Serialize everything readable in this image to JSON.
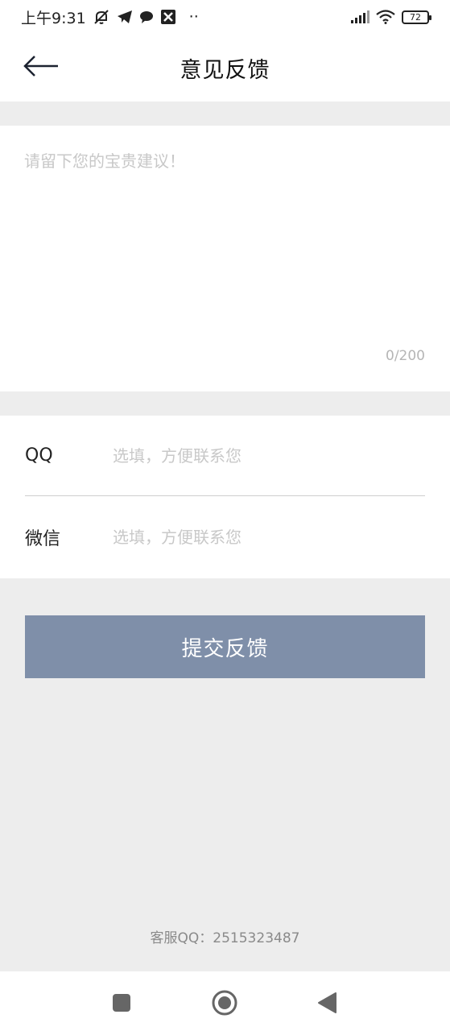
{
  "status_bar": {
    "time": "上午9:31",
    "dots": "··",
    "battery": "72",
    "icons": [
      "muted-bell-icon",
      "telegram-icon",
      "chat-bubble-icon",
      "app-notification-icon",
      "signal-icon",
      "wifi-icon",
      "battery-icon"
    ]
  },
  "header": {
    "title": "意见反馈",
    "back_icon": "arrow-left-icon"
  },
  "feedback": {
    "placeholder": "请留下您的宝贵建议！",
    "value": "",
    "counter": "0/200"
  },
  "contact": {
    "qq": {
      "label": "QQ",
      "placeholder": "选填，方便联系您",
      "value": ""
    },
    "wechat": {
      "label": "微信",
      "placeholder": "选填，方便联系您",
      "value": ""
    }
  },
  "submit": {
    "label": "提交反馈",
    "color": "#7f8fa9"
  },
  "service": {
    "text": "客服QQ：2515323487"
  },
  "nav_bar": {
    "icons": [
      "square-recents-icon",
      "circle-home-icon",
      "triangle-back-icon"
    ]
  },
  "colors": {
    "background": "#ededed",
    "card": "#ffffff",
    "placeholder": "#c8c8c8",
    "accent": "#7f8fa9"
  }
}
